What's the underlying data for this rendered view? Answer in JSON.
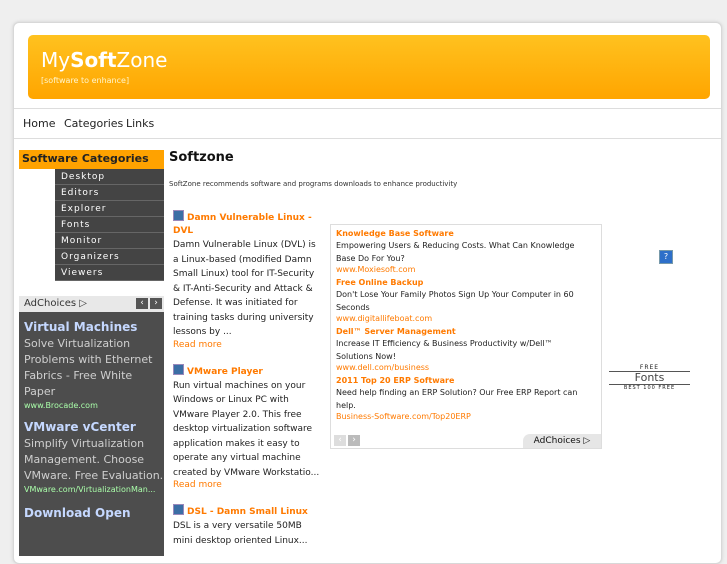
{
  "header": {
    "logo_my": "My",
    "logo_soft": "Soft",
    "logo_zone": "Zone",
    "tagline": "[software to enhance]"
  },
  "nav": [
    "Home",
    "Categories",
    "Links"
  ],
  "sidebar": {
    "title": "Software Categories",
    "items": [
      "Desktop",
      "Editors",
      "Explorer",
      "Fonts",
      "Monitor",
      "Organizers",
      "Viewers"
    ]
  },
  "left_ads": {
    "label": "AdChoices ▷",
    "items": [
      {
        "title": "Virtual Machines",
        "desc": "Solve Virtualization Problems with Ethernet Fabrics - Free White Paper",
        "url": "www.Brocade.com"
      },
      {
        "title": "VMware vCenter",
        "desc": "Simplify Virtualization Management. Choose VMware. Free Evaluation.",
        "url": "VMware.com/VirtualizationMan..."
      },
      {
        "title": "Download Open",
        "desc": "",
        "url": ""
      }
    ]
  },
  "main": {
    "title": "Softzone",
    "intro": "SoftZone recommends software and programs downloads to enhance productivity",
    "articles": [
      {
        "title": "Damn Vulnerable Linux - DVL",
        "body": "Damn Vulnerable Linux (DVL) is a Linux-based (modified Damn Small Linux) tool for IT-Security & IT-Anti-Security and Attack & Defense. It was initiated for training tasks during university lessons by ...",
        "more": "Read more"
      },
      {
        "title": "VMware Player",
        "body": "Run virtual machines on your Windows or Linux PC with VMware Player 2.0. This free desktop virtualization software application makes it easy to operate any virtual machine created by VMware Workstatio...",
        "more": "Read more"
      },
      {
        "title": "DSL - Damn Small Linux",
        "body": "DSL is a very versatile 50MB mini desktop oriented Linux...",
        "more": ""
      }
    ]
  },
  "mid_ads": {
    "items": [
      {
        "title": "Knowledge Base Software",
        "desc": "Empowering Users & Reducing Costs. What Can Knowledge Base Do For You?",
        "url": "www.Moxiesoft.com"
      },
      {
        "title": "Free Online Backup",
        "desc": "Don't Lose Your Family Photos Sign Up Your Computer in 60 Seconds",
        "url": "www.digitallifeboat.com"
      },
      {
        "title": "Dell™ Server Management",
        "desc": "Increase IT Efficiency & Business Productivity w/Dell™ Solutions Now!",
        "url": "www.dell.com/business"
      },
      {
        "title": "2011 Top 20 ERP Software",
        "desc": "Need help finding an ERP Solution? Our Free ERP Report can help.",
        "url": "Business-Software.com/Top20ERP"
      }
    ],
    "choices": "AdChoices ▷"
  },
  "fonts_badge": {
    "free": "FREE",
    "fonts": "Fonts",
    "best": "BEST 100 FREE"
  },
  "help_icon": "?"
}
